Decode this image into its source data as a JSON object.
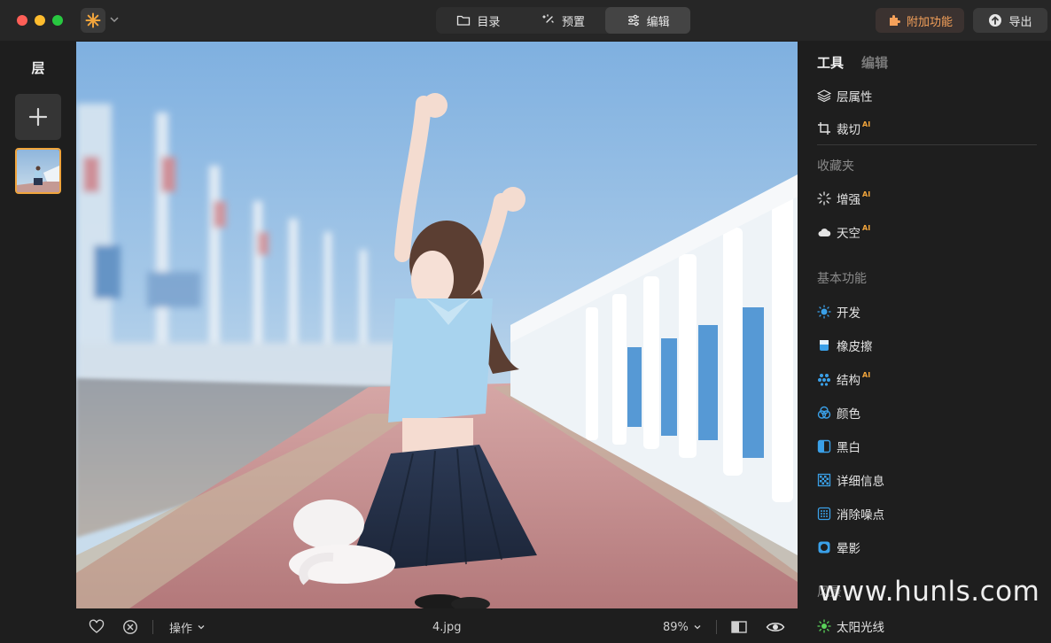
{
  "titlebar": {
    "nav": [
      {
        "label": "目录",
        "icon": "folder-icon"
      },
      {
        "label": "预置",
        "icon": "magic-wand-icon"
      },
      {
        "label": "编辑",
        "icon": "sliders-icon"
      }
    ],
    "addon_label": "附加功能",
    "export_label": "导出"
  },
  "layers": {
    "title": "层"
  },
  "bottom": {
    "actions_label": "操作",
    "filename": "4.jpg",
    "zoom": "89%"
  },
  "panel": {
    "tabs": [
      "工具",
      "编辑"
    ],
    "tools": [
      {
        "label": "层属性",
        "icon": "layers-icon",
        "ai": ""
      },
      {
        "label": "裁切",
        "icon": "crop-icon",
        "ai": "AI"
      }
    ],
    "favorites_title": "收藏夹",
    "favorites": [
      {
        "label": "增强",
        "icon": "sparkle-icon",
        "ai": "AI"
      },
      {
        "label": "天空",
        "icon": "cloud-icon",
        "ai": "AI"
      }
    ],
    "basic_title": "基本功能",
    "basic": [
      {
        "label": "开发",
        "icon": "sun-icon",
        "ai": ""
      },
      {
        "label": "橡皮擦",
        "icon": "eraser-icon",
        "ai": ""
      },
      {
        "label": "结构",
        "icon": "structure-icon",
        "ai": "AI"
      },
      {
        "label": "颜色",
        "icon": "color-icon",
        "ai": ""
      },
      {
        "label": "黑白",
        "icon": "black-white-icon",
        "ai": ""
      },
      {
        "label": "详细信息",
        "icon": "details-icon",
        "ai": ""
      },
      {
        "label": "消除噪点",
        "icon": "denoise-icon",
        "ai": ""
      },
      {
        "label": "晕影",
        "icon": "vignette-icon",
        "ai": ""
      }
    ],
    "more_title": "风景",
    "more": [
      {
        "label": "太阳光线",
        "icon": "sun-rays-icon",
        "ai": ""
      }
    ]
  },
  "watermark": "www.hunls.com",
  "colors": {
    "accent": "#f0a43c",
    "tool_blue": "#3aa0e8",
    "background": "#1e1e1e"
  }
}
